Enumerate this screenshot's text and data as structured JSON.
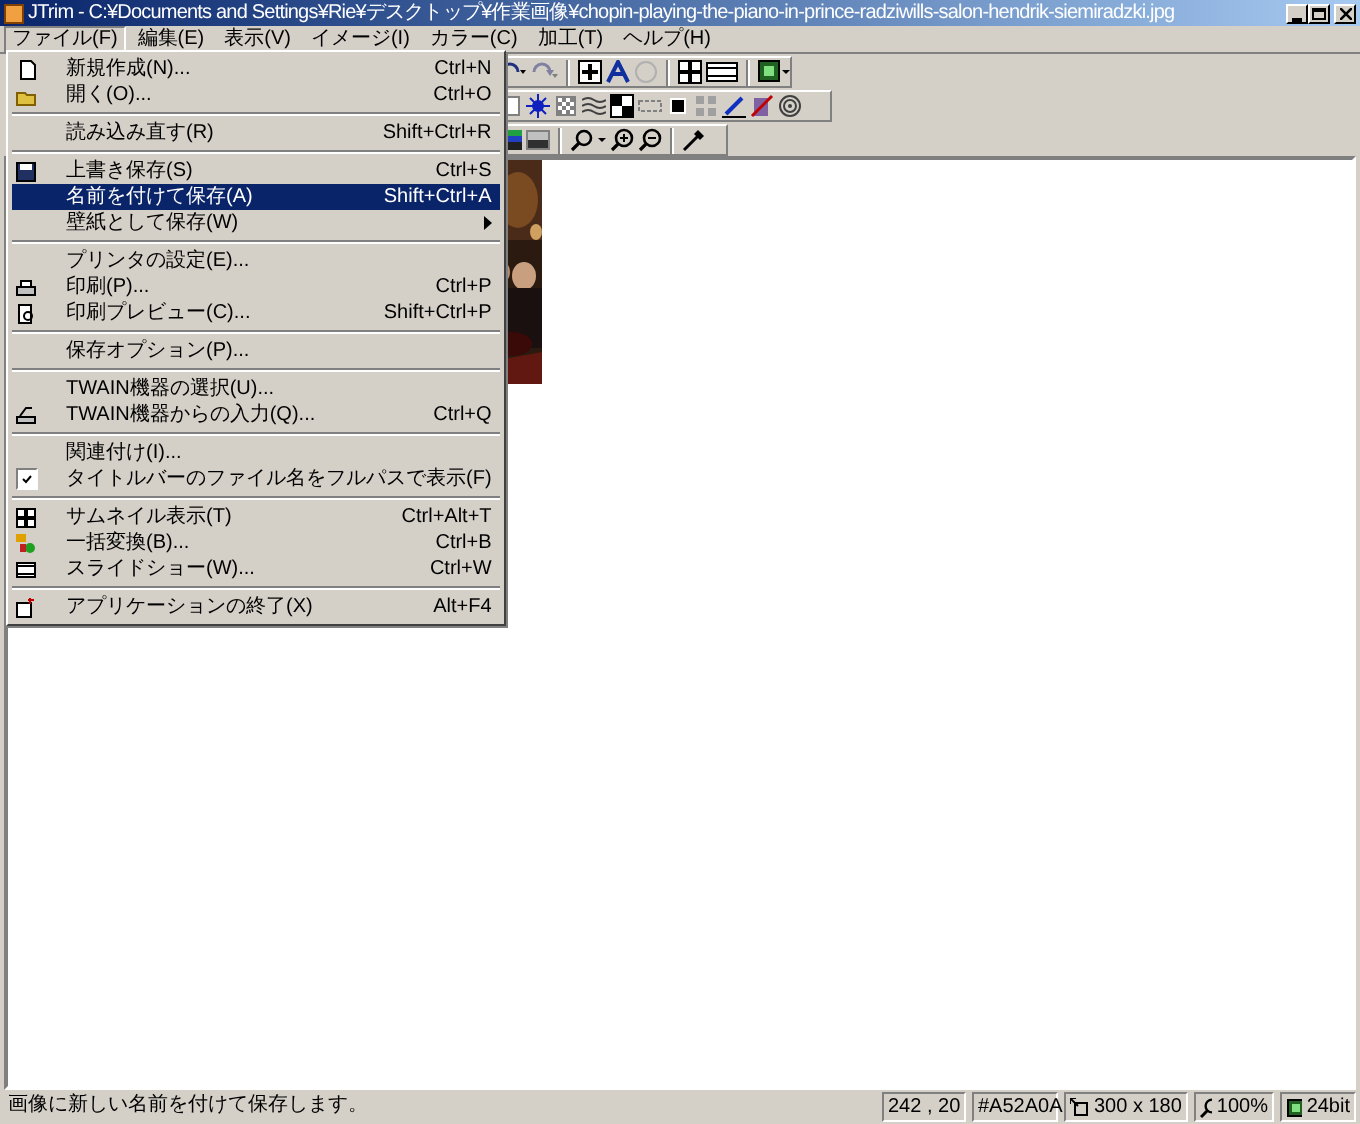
{
  "window": {
    "title": "JTrim - C:¥Documents and Settings¥Rie¥デスクトップ¥作業画像¥chopin-playing-the-piano-in-prince-radziwills-salon-hendrik-siemiradzki.jpg"
  },
  "menubar": [
    {
      "label": "ファイル(F)",
      "selected": true
    },
    {
      "label": "編集(E)",
      "selected": false
    },
    {
      "label": "表示(V)",
      "selected": false
    },
    {
      "label": "イメージ(I)",
      "selected": false
    },
    {
      "label": "カラー(C)",
      "selected": false
    },
    {
      "label": "加工(T)",
      "selected": false
    },
    {
      "label": "ヘルプ(H)",
      "selected": false
    }
  ],
  "file_menu": {
    "groups": [
      [
        {
          "label": "新規作成(N)...",
          "shortcut": "Ctrl+N",
          "selected": false,
          "checked": false,
          "submenu": false
        },
        {
          "label": "開く(O)...",
          "shortcut": "Ctrl+O",
          "selected": false,
          "checked": false,
          "submenu": false
        }
      ],
      [
        {
          "label": "読み込み直す(R)",
          "shortcut": "Shift+Ctrl+R",
          "selected": false,
          "checked": false,
          "submenu": false
        }
      ],
      [
        {
          "label": "上書き保存(S)",
          "shortcut": "Ctrl+S",
          "selected": false,
          "checked": false,
          "submenu": false
        },
        {
          "label": "名前を付けて保存(A)",
          "shortcut": "Shift+Ctrl+A",
          "selected": true,
          "checked": false,
          "submenu": false
        },
        {
          "label": "壁紙として保存(W)",
          "selected": false,
          "checked": false,
          "submenu": true
        }
      ],
      [
        {
          "label": "プリンタの設定(E)...",
          "selected": false,
          "checked": false,
          "submenu": false
        },
        {
          "label": "印刷(P)...",
          "shortcut": "Ctrl+P",
          "selected": false,
          "checked": false,
          "submenu": false
        },
        {
          "label": "印刷プレビュー(C)...",
          "shortcut": "Shift+Ctrl+P",
          "selected": false,
          "checked": false,
          "submenu": false
        }
      ],
      [
        {
          "label": "保存オプション(P)...",
          "selected": false,
          "checked": false,
          "submenu": false
        }
      ],
      [
        {
          "label": "TWAIN機器の選択(U)...",
          "selected": false,
          "checked": false,
          "submenu": false
        },
        {
          "label": "TWAIN機器からの入力(Q)...",
          "shortcut": "Ctrl+Q",
          "selected": false,
          "checked": false,
          "submenu": false
        }
      ],
      [
        {
          "label": "関連付け(I)...",
          "selected": false,
          "checked": false,
          "submenu": false
        },
        {
          "label": "タイトルバーのファイル名をフルパスで表示(F)",
          "selected": false,
          "checked": true,
          "submenu": false
        }
      ],
      [
        {
          "label": "サムネイル表示(T)",
          "shortcut": "Ctrl+Alt+T",
          "selected": false,
          "checked": false,
          "submenu": false
        },
        {
          "label": "一括変換(B)...",
          "shortcut": "Ctrl+B",
          "selected": false,
          "checked": false,
          "submenu": false
        },
        {
          "label": "スライドショー(W)...",
          "shortcut": "Ctrl+W",
          "selected": false,
          "checked": false,
          "submenu": false
        }
      ],
      [
        {
          "label": "アプリケーションの終了(X)",
          "shortcut": "Alt+F4",
          "selected": false,
          "checked": false,
          "submenu": false
        }
      ]
    ]
  },
  "status_bar": {
    "message": "画像に新しい名前を付けて保存します。",
    "position": "242 , 20",
    "pixel_value": "#A52A0A",
    "size": "300 x 180",
    "zoom": "100%",
    "depth": "24bit"
  }
}
